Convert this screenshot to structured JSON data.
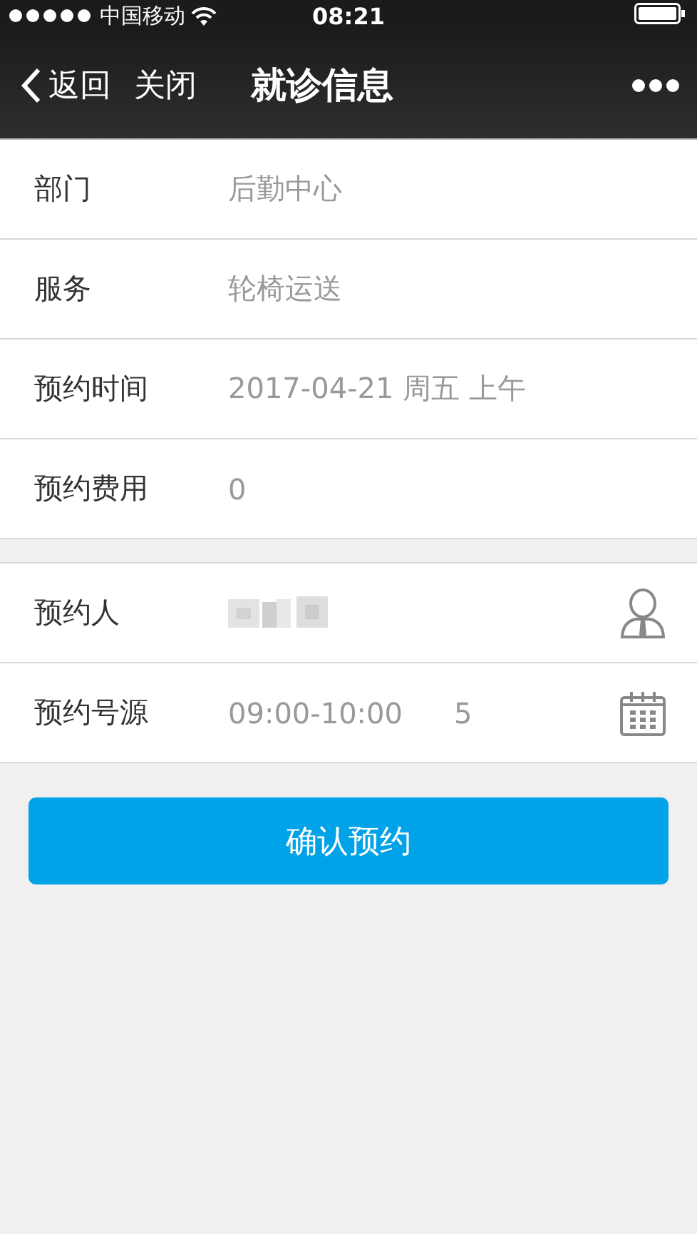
{
  "status_bar": {
    "carrier": "中国移动",
    "time": "08:21"
  },
  "nav": {
    "back": "返回",
    "close": "关闭",
    "title": "就诊信息"
  },
  "groups": [
    {
      "rows": [
        {
          "kind": "text",
          "label": "部门",
          "values": [
            "后勤中心"
          ]
        },
        {
          "kind": "text",
          "label": "服务",
          "values": [
            "轮椅运送"
          ]
        },
        {
          "kind": "text",
          "label": "预约时间",
          "values": [
            "2017-04-21 周五 上午"
          ]
        },
        {
          "kind": "text",
          "label": "预约费用",
          "values": [
            "0"
          ]
        }
      ]
    },
    {
      "rows": [
        {
          "kind": "person",
          "label": "预约人"
        },
        {
          "kind": "slot",
          "label": "预约号源",
          "values": [
            "09:00-10:00",
            "5"
          ]
        }
      ]
    }
  ],
  "confirm_button": "确认预约"
}
